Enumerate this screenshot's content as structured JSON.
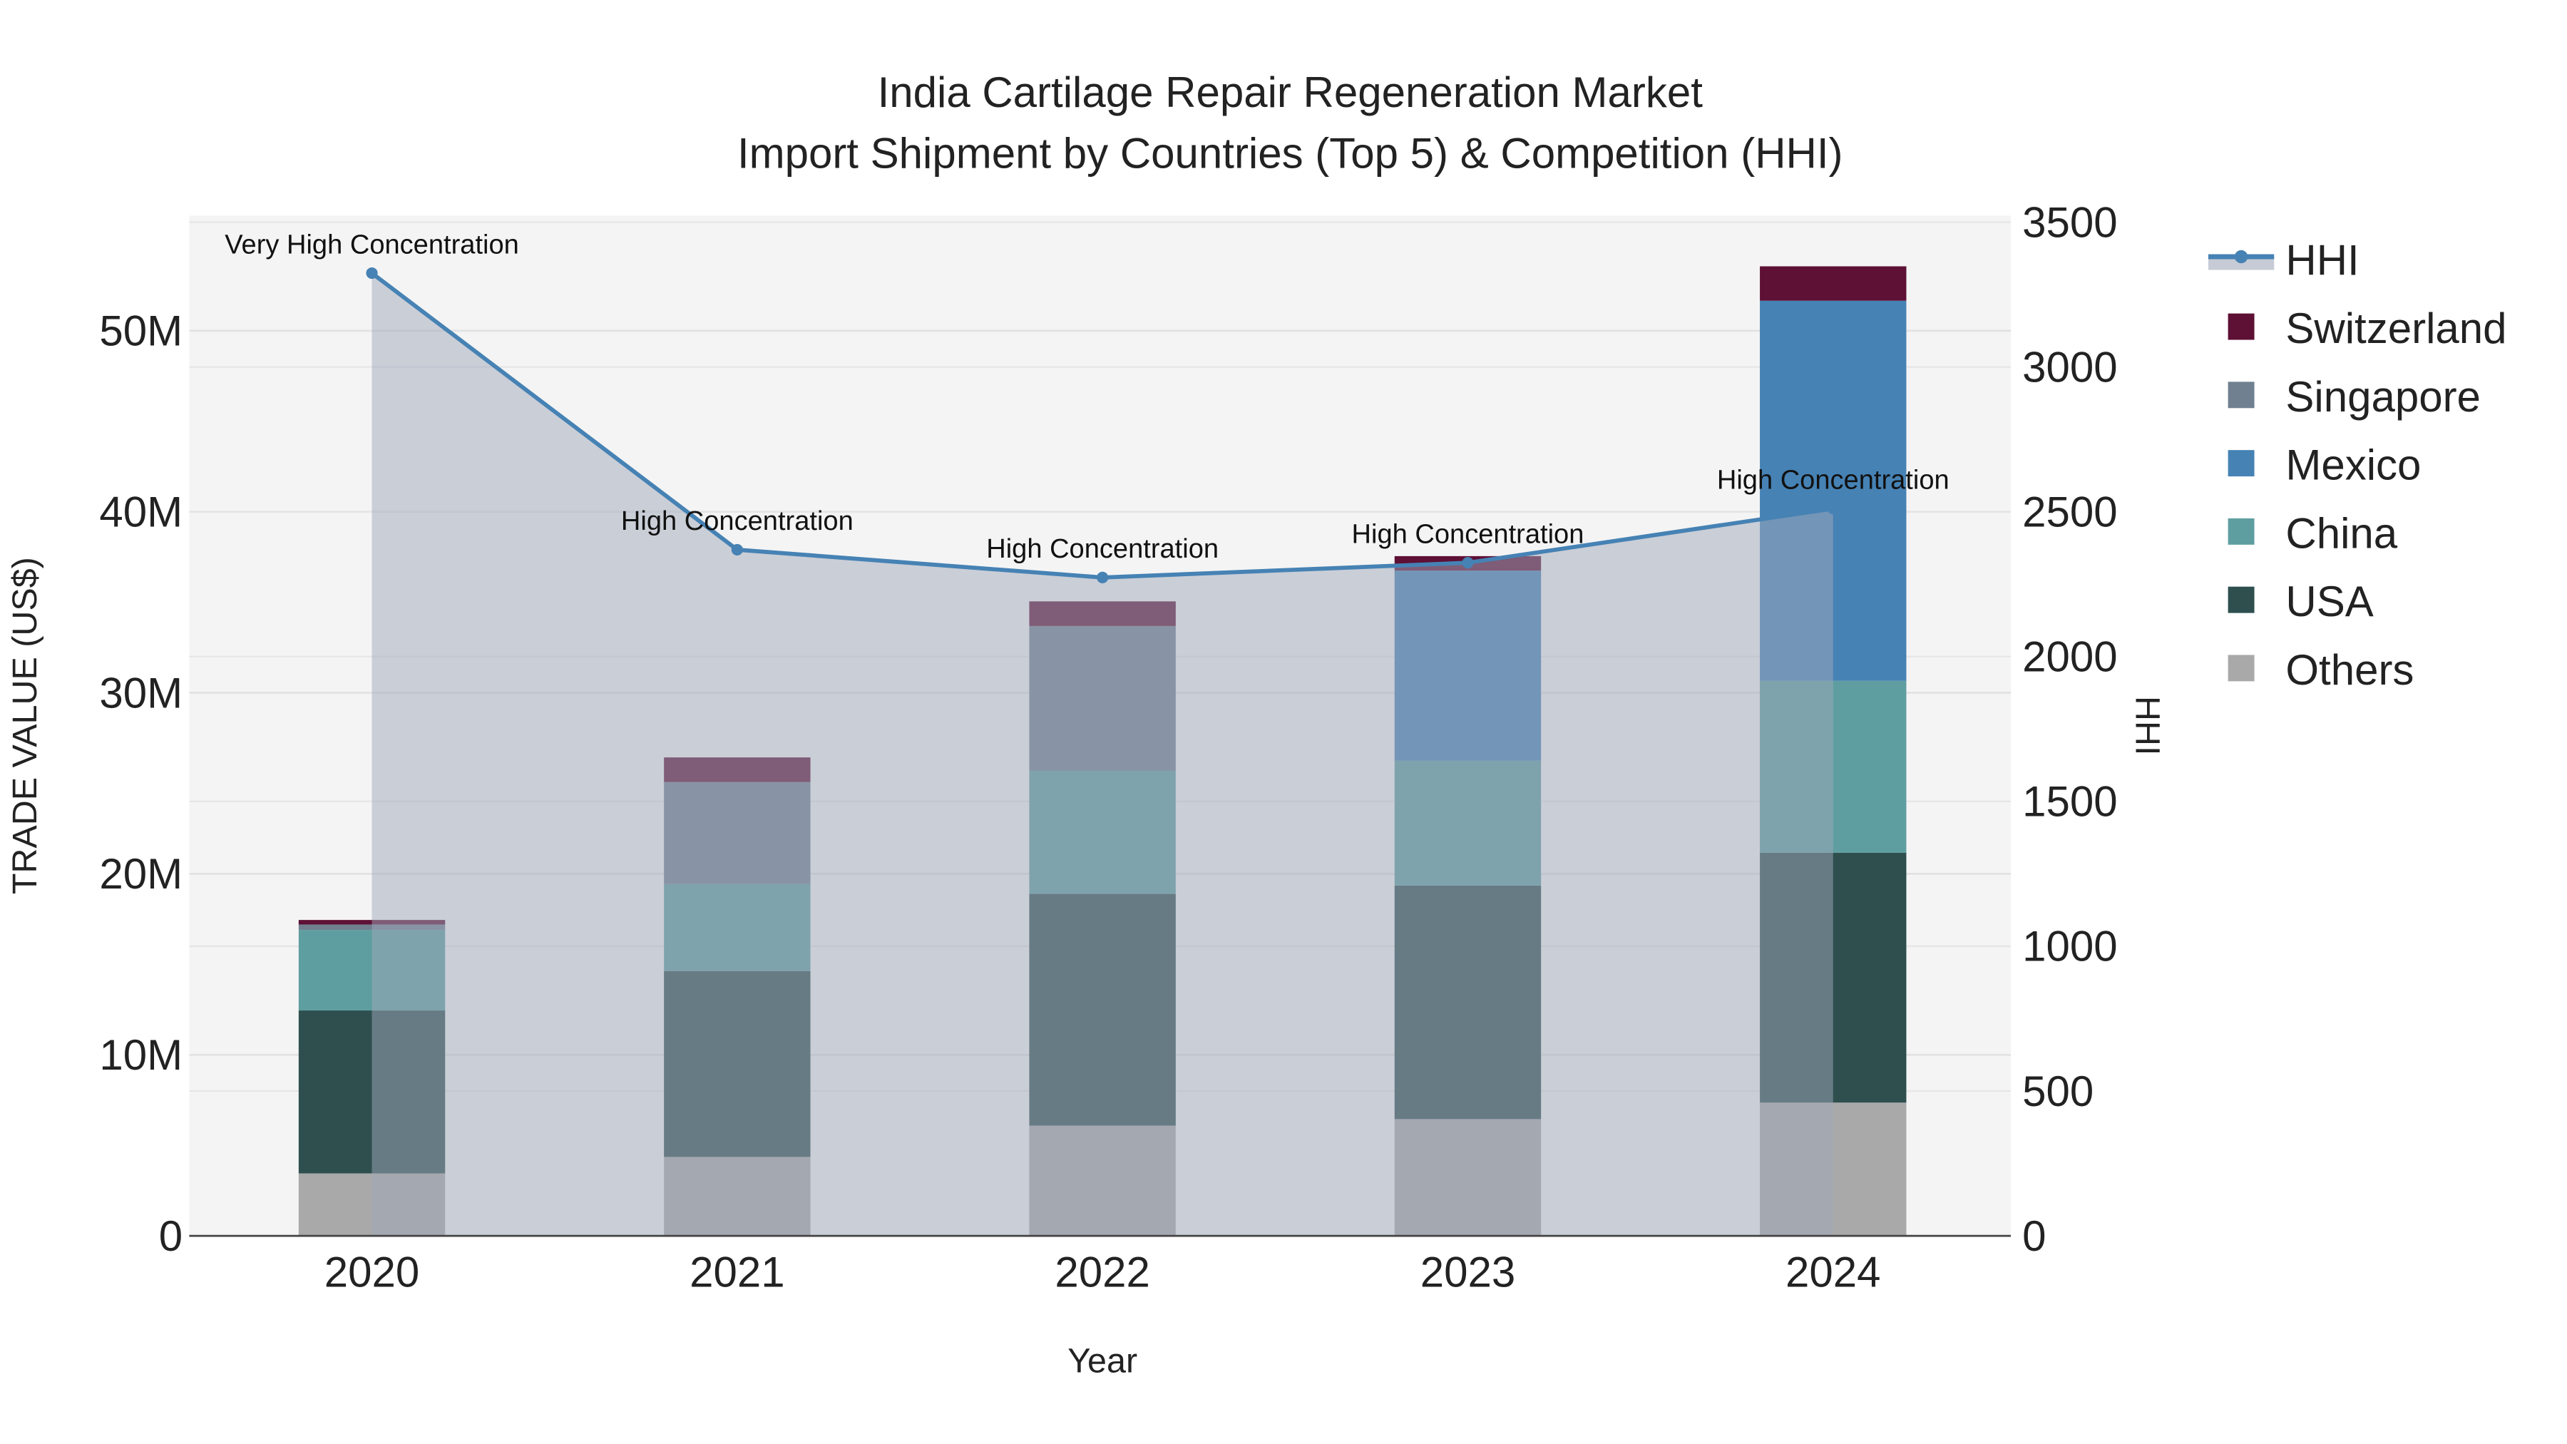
{
  "chart_data": {
    "type": "bar",
    "stacked": true,
    "title": "India Cartilage Repair Regeneration Market",
    "subtitle": "Import Shipment by Countries (Top 5) & Competition (HHI)",
    "xlabel": "Year",
    "ylabel": "TRADE VALUE (US$)",
    "y2label": "HHI",
    "categories": [
      "2020",
      "2021",
      "2022",
      "2023",
      "2024"
    ],
    "ylim": [
      0,
      56000000
    ],
    "y_ticks": [
      0,
      10000000,
      20000000,
      30000000,
      40000000,
      50000000
    ],
    "y_tick_labels": [
      "0",
      "10M",
      "20M",
      "30M",
      "40M",
      "50M"
    ],
    "y2lim": [
      0,
      3500
    ],
    "y2_ticks": [
      0,
      500,
      1000,
      1500,
      2000,
      2500,
      3000,
      3500
    ],
    "y2_tick_labels": [
      "0",
      "500",
      "1000",
      "1500",
      "2000",
      "2500",
      "3000",
      "3500"
    ],
    "series": [
      {
        "name": "Others",
        "color": "#a9a9a9",
        "values": [
          3450000,
          4360000,
          6090000,
          6450000,
          7360000
        ]
      },
      {
        "name": "USA",
        "color": "#2f4f4f",
        "values": [
          9000000,
          10270000,
          12800000,
          12900000,
          13800000
        ]
      },
      {
        "name": "China",
        "color": "#5f9ea0",
        "values": [
          4450000,
          4800000,
          6800000,
          6900000,
          9500000
        ]
      },
      {
        "name": "Mexico",
        "color": "#4682b4",
        "values": [
          0,
          0,
          0,
          10500000,
          21000000
        ]
      },
      {
        "name": "Singapore",
        "color": "#708090",
        "values": [
          300000,
          5640000,
          8000000,
          0,
          0
        ]
      },
      {
        "name": "Switzerland",
        "color": "#5e1035",
        "values": [
          250000,
          1360000,
          1360000,
          800000,
          1900000
        ]
      }
    ],
    "line": {
      "name": "HHI",
      "color": "#4682b4",
      "values": [
        3324,
        2369,
        2273,
        2324,
        2511
      ],
      "annotations": [
        "Very High Concentration",
        "High Concentration",
        "High Concentration",
        "High Concentration",
        "High Concentration"
      ]
    },
    "legend_order": [
      "HHI",
      "Switzerland",
      "Singapore",
      "Mexico",
      "China",
      "USA",
      "Others"
    ],
    "legend_position": "right",
    "grid": true
  }
}
